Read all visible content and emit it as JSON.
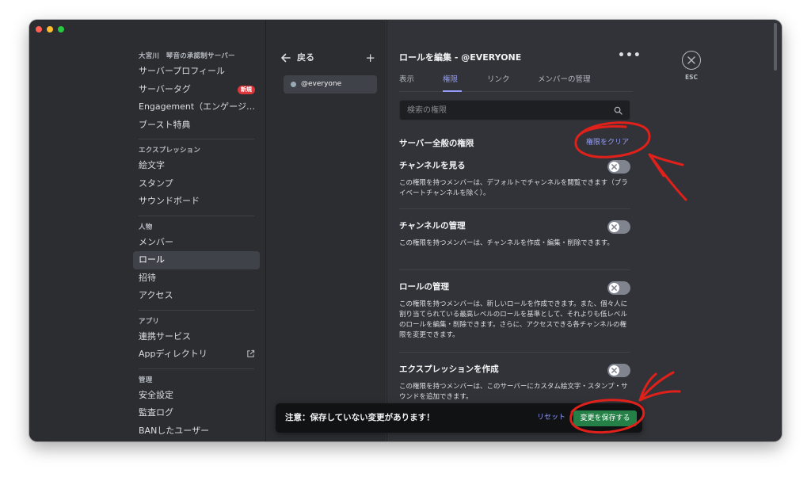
{
  "sidebar": {
    "server_header": "大宮川　琴音の承認制サーバー",
    "server_items": [
      {
        "label": "サーバープロフィール"
      },
      {
        "label": "サーバータグ",
        "badge": "新規"
      },
      {
        "label": "Engagement（エンゲージメ..."
      },
      {
        "label": "ブースト特典"
      }
    ],
    "expression_header": "エクスプレッション",
    "expression_items": [
      {
        "label": "絵文字"
      },
      {
        "label": "スタンプ"
      },
      {
        "label": "サウンドボード"
      }
    ],
    "people_header": "人物",
    "people_items": [
      {
        "label": "メンバー"
      },
      {
        "label": "ロール"
      },
      {
        "label": "招待"
      },
      {
        "label": "アクセス"
      }
    ],
    "apps_header": "アプリ",
    "apps_items": [
      {
        "label": "連携サービス"
      },
      {
        "label": "Appディレクトリ"
      }
    ],
    "mod_header": "管理",
    "mod_items": [
      {
        "label": "安全設定"
      },
      {
        "label": "監査ログ"
      },
      {
        "label": "BANしたユーザー"
      }
    ]
  },
  "roles_panel": {
    "back_label": "戻る",
    "role": "@everyone"
  },
  "main": {
    "title": "ロールを編集 - @EVERYONE",
    "tabs": [
      "表示",
      "権限",
      "リンク",
      "メンバーの管理"
    ],
    "active_tab": "権限",
    "search_placeholder": "検索の権限",
    "section_title": "サーバー全般の権限",
    "clear_label": "権限をクリア",
    "permissions": [
      {
        "title": "チャンネルを見る",
        "desc": "この権限を持つメンバーは、デフォルトでチャンネルを閲覧できます（プライベートチャンネルを除く）。",
        "enabled": false
      },
      {
        "title": "チャンネルの管理",
        "desc": "この権限を持つメンバーは、チャンネルを作成・編集・削除できます。",
        "enabled": false
      },
      {
        "title": "ロールの管理",
        "desc": "この権限を持つメンバーは、新しいロールを作成できます。また、個々人に割り当てられている最高レベルのロールを基準として、それよりも低レベルのロールを編集・削除できます。さらに、アクセスできる各チャンネルの権限を変更できます。",
        "enabled": false
      },
      {
        "title": "エクスプレッションを作成",
        "desc": "この権限を持つメンバーは、このサーバーにカスタム絵文字・スタンプ・サウンドを追加できます。",
        "enabled": false
      }
    ],
    "esc_label": "ESC"
  },
  "notice": {
    "text": "注意：保存していない変更があります！",
    "reset_label": "リセット",
    "save_label": "変更を保存する"
  },
  "colors": {
    "accent": "#949cf7",
    "save_green": "#248046",
    "annotation_red": "#e0201a"
  }
}
